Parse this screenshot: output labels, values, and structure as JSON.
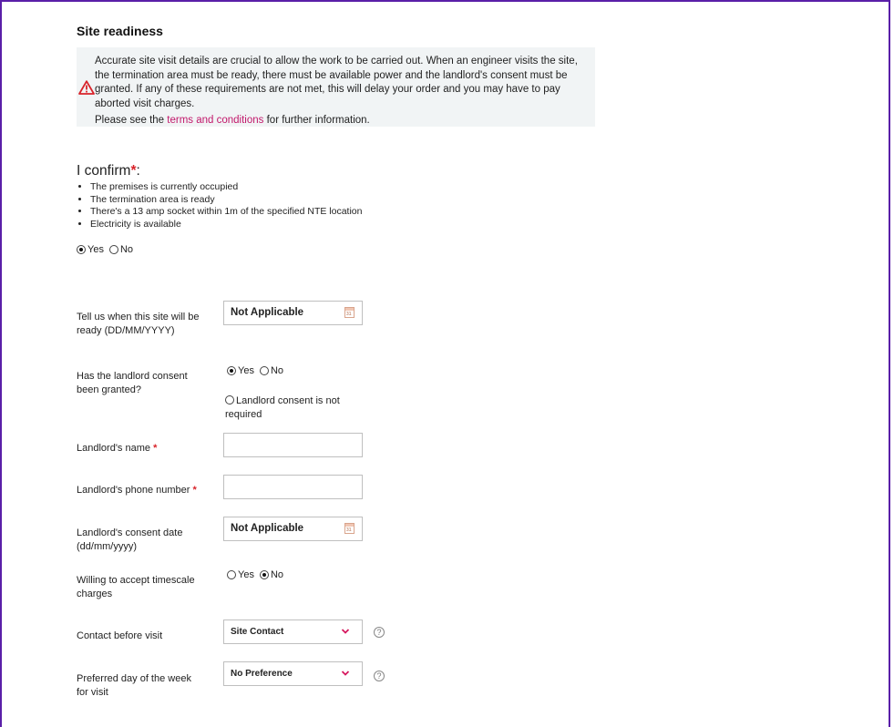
{
  "section": {
    "title": "Site readiness",
    "notice_text": "Accurate site visit details are crucial to allow the work to be carried out. When an engineer visits the site, the termination area must be ready, there must be available power and the landlord's consent must be granted. If any of these requirements are not met, this will delay your order and you may have to pay aborted visit charges.",
    "notice_see_prefix": "Please see the ",
    "notice_link": "terms and conditions",
    "notice_see_suffix": " for further information."
  },
  "confirm": {
    "heading": "I confirm",
    "required_mark": "*",
    "colon": ":",
    "items": [
      "The premises is currently occupied",
      "The termination area is ready",
      "There's a 13 amp socket within 1m of the specified NTE location",
      "Electricity is available"
    ],
    "yes_label": "Yes",
    "no_label": "No",
    "selected": "Yes"
  },
  "form": {
    "site_ready": {
      "label": "Tell us when this site will be ready (DD/MM/YYYY)",
      "value": "Not Applicable"
    },
    "landlord_consent": {
      "label": "Has the landlord consent been granted?",
      "yes_label": "Yes",
      "no_label": "No",
      "not_required_label": "Landlord consent is not required",
      "selected": "Yes"
    },
    "landlord_name": {
      "label": "Landlord's name",
      "required_mark": "*",
      "value": ""
    },
    "landlord_phone": {
      "label": "Landlord's phone number",
      "required_mark": "*",
      "value": ""
    },
    "consent_date": {
      "label": "Landlord's consent date (dd/mm/yyyy)",
      "value": "Not Applicable"
    },
    "timescale_charges": {
      "label": "Willing to accept timescale charges",
      "yes_label": "Yes",
      "no_label": "No",
      "selected": "No"
    },
    "contact_before_visit": {
      "label": "Contact before visit",
      "value": "Site Contact"
    },
    "preferred_day": {
      "label": "Preferred day of the week for visit",
      "value": "No Preference"
    }
  },
  "calendar_glyph": "31",
  "help_glyph": "?",
  "colors": {
    "frame": "#5a1fa8",
    "link": "#c2186b",
    "required": "#d8232a",
    "chevron": "#d6195f",
    "notice_bg": "#f1f4f5"
  },
  "icons": [
    "warning-icon",
    "calendar-icon",
    "chevron-down-icon",
    "help-icon"
  ]
}
